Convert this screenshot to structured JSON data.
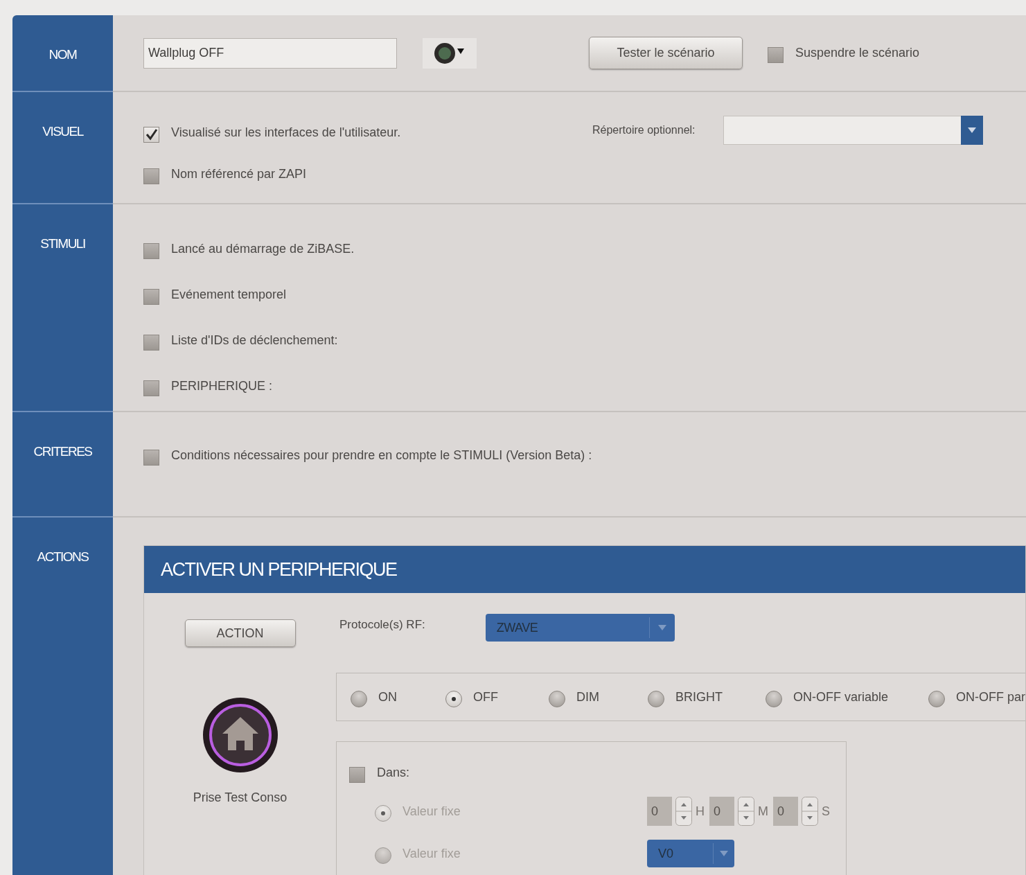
{
  "sidebar": {
    "items": [
      {
        "label": "NOM"
      },
      {
        "label": "VISUEL"
      },
      {
        "label": "STIMULI"
      },
      {
        "label": "CRITERES"
      },
      {
        "label": "ACTIONS"
      }
    ]
  },
  "nom": {
    "name_field": {
      "value": "Wallplug OFF"
    },
    "test_button": "Tester le scénario",
    "suspend": {
      "label": "Suspendre le scénario",
      "checked": false
    }
  },
  "visuel": {
    "options": [
      {
        "label": "Visualisé sur les interfaces de l'utilisateur.",
        "checked": true
      },
      {
        "label": "Nom référencé par ZAPI",
        "checked": false
      }
    ],
    "directory": {
      "label": "Répertoire optionnel:"
    }
  },
  "stimuli": {
    "options": [
      {
        "label": "Lancé au démarrage de ZiBASE.",
        "checked": false
      },
      {
        "label": "Evénement temporel",
        "checked": false
      },
      {
        "label": "Liste d'IDs de déclenchement:",
        "checked": false
      },
      {
        "label": "PERIPHERIQUE :",
        "checked": false
      }
    ]
  },
  "criteres": {
    "options": [
      {
        "label": "Conditions nécessaires pour prendre en compte le STIMULI (Version Beta) :",
        "checked": false
      }
    ]
  },
  "actions": {
    "panel_title": "ACTIVER UN PERIPHERIQUE",
    "action_button": "ACTION",
    "device_name": "Prise Test Conso",
    "protocol": {
      "label": "Protocole(s) RF:",
      "value": "ZWAVE"
    },
    "commands": [
      {
        "label": "ON",
        "selected": false
      },
      {
        "label": "OFF",
        "selected": true
      },
      {
        "label": "DIM",
        "selected": false
      },
      {
        "label": "BRIGHT",
        "selected": false
      },
      {
        "label": "ON-OFF variable",
        "selected": false
      },
      {
        "label": "ON-OFF par",
        "selected": false
      }
    ],
    "dans": {
      "label": "Dans:",
      "checked": false
    },
    "delay_options": [
      {
        "label": "Valeur fixe",
        "selected": true,
        "disabled": true
      },
      {
        "label": "Valeur fixe",
        "selected": false,
        "disabled": true
      }
    ],
    "time": [
      {
        "value": "0",
        "unit": "H"
      },
      {
        "value": "0",
        "unit": "M"
      },
      {
        "value": "0",
        "unit": "S"
      }
    ],
    "variable": {
      "value": "V0"
    }
  }
}
